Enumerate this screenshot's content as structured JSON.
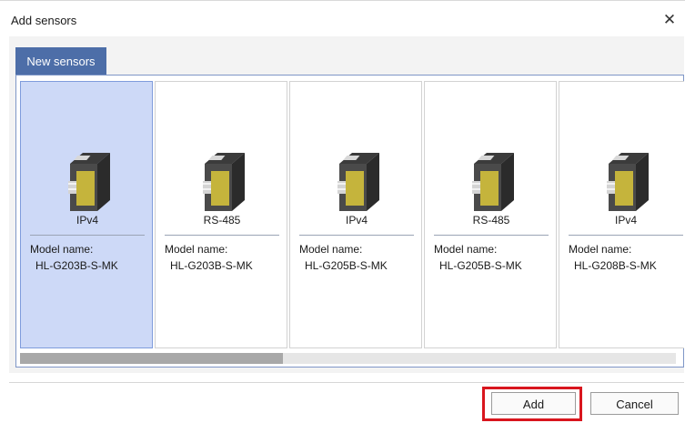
{
  "window": {
    "title": "Add sensors"
  },
  "tabs": [
    {
      "label": "New sensors"
    }
  ],
  "sensors": [
    {
      "connection": "IPv4",
      "model_label": "Model name:",
      "model": "HL-G203B-S-MK",
      "selected": true
    },
    {
      "connection": "RS-485",
      "model_label": "Model name:",
      "model": "HL-G203B-S-MK",
      "selected": false
    },
    {
      "connection": "IPv4",
      "model_label": "Model name:",
      "model": "HL-G205B-S-MK",
      "selected": false
    },
    {
      "connection": "RS-485",
      "model_label": "Model name:",
      "model": "HL-G205B-S-MK",
      "selected": false
    },
    {
      "connection": "IPv4",
      "model_label": "Model name:",
      "model": "HL-G208B-S-MK",
      "selected": false
    }
  ],
  "scrollbar": {
    "position": 0.0,
    "visible_fraction": 0.4
  },
  "buttons": {
    "add": "Add",
    "cancel": "Cancel"
  },
  "colors": {
    "tab": "#4d6ea8",
    "selected_card": "#cdd9f7",
    "highlight": "#d9161e",
    "sensor_face": "#c5b43c"
  }
}
